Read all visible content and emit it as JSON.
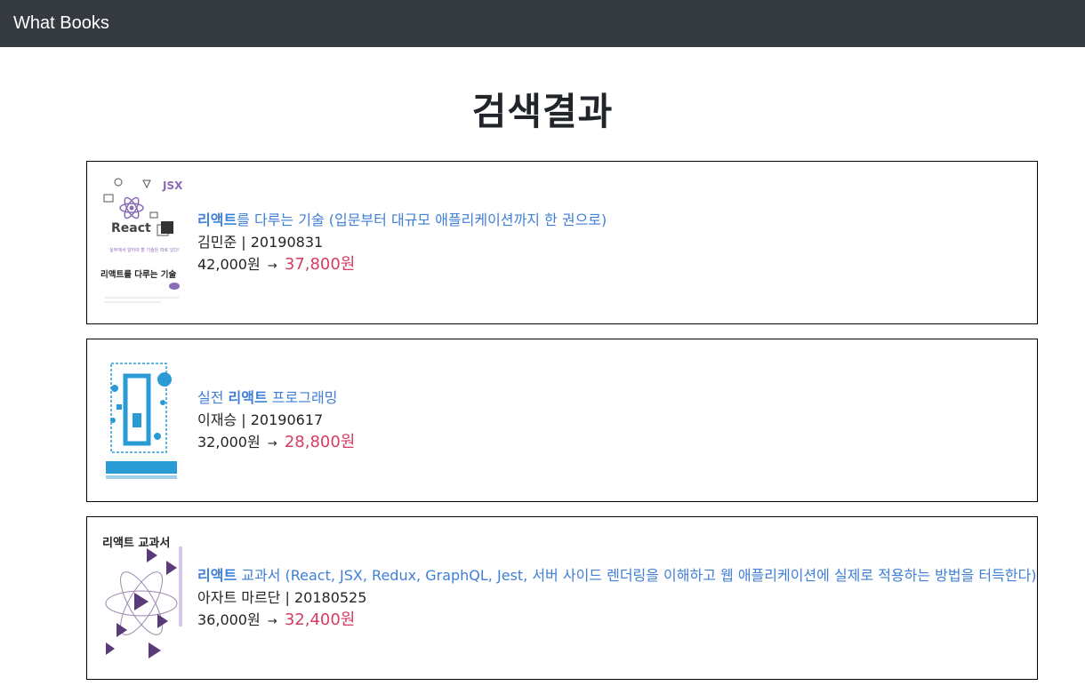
{
  "navbar": {
    "brand": "What Books"
  },
  "page": {
    "title": "검색결과"
  },
  "books": [
    {
      "title_highlight": "리액트",
      "title_prefix": "",
      "title_suffix": "를 다루는 기술 (입문부터 대규모 애플리케이션까지 한 권으로)",
      "author": "김민준",
      "date": "20190831",
      "price": "42,000원",
      "arrow": "→",
      "sale_price": "37,800원",
      "cover_text": {
        "logo": "React",
        "tagline": "실무에서 알아야 할 기술은 따로 있다!",
        "title": "리액트를 다루는 기술",
        "badge": "JSX"
      }
    },
    {
      "title_highlight": "리액트",
      "title_prefix": "실전 ",
      "title_suffix": " 프로그래밍",
      "author": "이재승",
      "date": "20190617",
      "price": "32,000원",
      "arrow": "→",
      "sale_price": "28,800원"
    },
    {
      "title_highlight": "리액트",
      "title_prefix": "",
      "title_suffix": " 교과서 (React, JSX, Redux, GraphQL, Jest, 서버 사이드 렌더링을 이해하고 웹 애플리케이션에 실제로 적용하는 방법을 터득한다)",
      "author": "아자트 마르단",
      "date": "20180525",
      "price": "36,000원",
      "arrow": "→",
      "sale_price": "32,400원",
      "cover_text": {
        "title": "리액트 교과서"
      }
    }
  ]
}
